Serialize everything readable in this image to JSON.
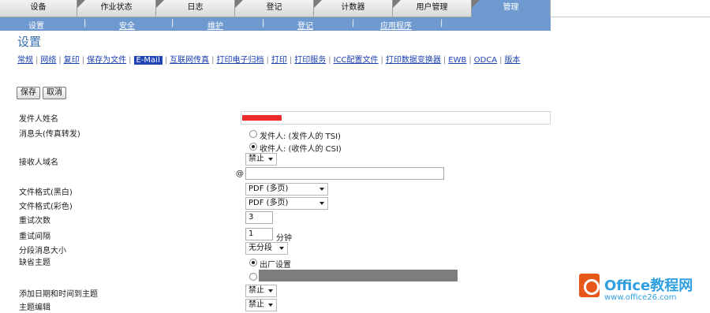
{
  "top_tabs": [
    {
      "label": "设备",
      "active": false
    },
    {
      "label": "作业状态",
      "active": false
    },
    {
      "label": "日志",
      "active": false
    },
    {
      "label": "登记",
      "active": false
    },
    {
      "label": "计数器",
      "active": false
    },
    {
      "label": "用户管理",
      "active": false
    },
    {
      "label": "管理",
      "active": true
    }
  ],
  "subnav": {
    "current": "设置",
    "items": [
      "安全",
      "维护",
      "登记",
      "应用程序"
    ],
    "separator": "|"
  },
  "page_title": "设置",
  "settings_links": {
    "separator": "|",
    "items": [
      {
        "label": "常规",
        "current": false
      },
      {
        "label": "网络",
        "current": false
      },
      {
        "label": "复印",
        "current": false
      },
      {
        "label": "保存为文件",
        "current": false
      },
      {
        "label": "E-Mail",
        "current": true
      },
      {
        "label": "互联网传真",
        "current": false
      },
      {
        "label": "打印电子归档",
        "current": false
      },
      {
        "label": "打印",
        "current": false
      },
      {
        "label": "打印服务",
        "current": false
      },
      {
        "label": "ICC配置文件",
        "current": false
      },
      {
        "label": "打印数据变换器",
        "current": false
      },
      {
        "label": "EWB",
        "current": false
      },
      {
        "label": "ODCA",
        "current": false
      },
      {
        "label": "版本",
        "current": false
      }
    ]
  },
  "buttons": {
    "save": "保存",
    "cancel": "取消"
  },
  "form": {
    "sender_name": {
      "label": "发件人姓名",
      "value": ""
    },
    "message_header": {
      "label": "消息头(传真转发)",
      "options": [
        {
          "label": "发件人: (发件人的  TSI)",
          "selected": false
        },
        {
          "label": "收件人: (收件人的  CSI)",
          "selected": true
        }
      ]
    },
    "recipient_domain": {
      "label": "接收人域名",
      "select_value": "禁止",
      "at_sign": "@",
      "domain_value": ""
    },
    "file_format_bw": {
      "label": "文件格式(黑白)",
      "value": "PDF (多页)"
    },
    "file_format_color": {
      "label": "文件格式(彩色)",
      "value": "PDF (多页)"
    },
    "retry_count": {
      "label": "重试次数",
      "value": "3"
    },
    "retry_interval": {
      "label": "重试间隔",
      "value": "1",
      "unit": "分钟"
    },
    "split_message_size": {
      "label": "分段消息大小",
      "value": "无分段"
    },
    "default_subject": {
      "label": "缺省主题",
      "options": [
        {
          "label": "出厂设置",
          "selected": true
        },
        {
          "label": "",
          "selected": false
        }
      ]
    },
    "add_datetime_subject": {
      "label": "添加日期和时间到主题",
      "value": "禁止"
    },
    "subject_edit": {
      "label": "主题编辑",
      "value": "禁止"
    }
  },
  "watermark": {
    "title": "Office教程网",
    "url": "www.office26.com"
  },
  "colors": {
    "nav_blue": "#6f9ad0",
    "link_blue": "#1a3fb0",
    "current_link_bg": "#1d43b5",
    "title_blue": "#3a6fb0",
    "redaction_red": "#ef2b2b",
    "watermark_orange": "#e8571a",
    "watermark_blue": "#2f9fe0"
  }
}
